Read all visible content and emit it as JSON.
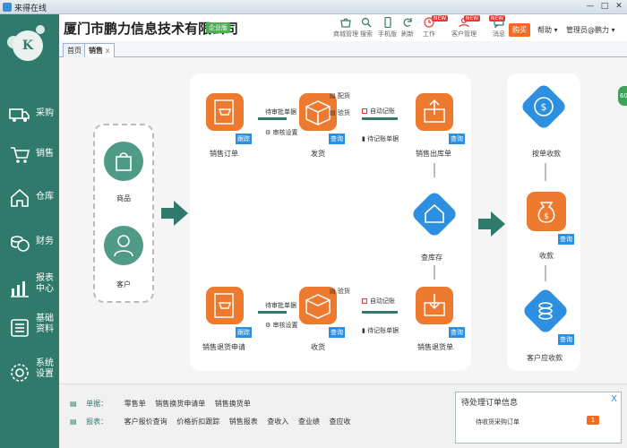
{
  "window": {
    "title": "来得在线",
    "min": "—",
    "max": "□",
    "close": "✕"
  },
  "sidebar": {
    "logo": "K",
    "items": [
      {
        "label": "采购",
        "icon": "truck-icon"
      },
      {
        "label": "销售",
        "icon": "cart-icon"
      },
      {
        "label": "仓库",
        "icon": "house-icon"
      },
      {
        "label": "财务",
        "icon": "coins-icon"
      },
      {
        "label": "报表中心",
        "line1": "报表",
        "line2": "中心",
        "icon": "bar-chart-icon"
      },
      {
        "label": "基础资料",
        "line1": "基础",
        "line2": "资料",
        "icon": "list-icon"
      },
      {
        "label": "系统设置",
        "line1": "系统",
        "line2": "设置",
        "icon": "gear-icon"
      }
    ]
  },
  "header": {
    "company": "厦门市鹏力信息技术有限公司",
    "edition": "企业版",
    "tools": [
      {
        "label": "商城管理",
        "icon": "store-icon"
      },
      {
        "label": "搜索",
        "icon": "search-icon"
      },
      {
        "label": "手机版",
        "icon": "phone-icon"
      },
      {
        "label": "刷新",
        "icon": "refresh-icon"
      },
      {
        "label": "工作",
        "icon": "clock-icon",
        "badge": "NEW"
      },
      {
        "label": "客户管理",
        "icon": "customer-icon",
        "badge": "NEW"
      },
      {
        "label": "消息",
        "icon": "message-icon",
        "badge": "NEW"
      }
    ],
    "buy": "购买",
    "help": "帮助",
    "user": "管理员@鹏力"
  },
  "tabs": [
    {
      "label": "首页"
    },
    {
      "label": "销售",
      "close": "x"
    }
  ],
  "flow": {
    "left": [
      {
        "label": "商品",
        "icon": "bag-icon"
      },
      {
        "label": "客户",
        "icon": "person-icon"
      }
    ],
    "sales_order": {
      "label": "销售订单",
      "tag": "跟踪"
    },
    "deliver": {
      "label": "发货",
      "tag": "查询"
    },
    "out_stock": {
      "label": "销售出库单",
      "tag": "查询"
    },
    "return_req": {
      "label": "销售退货申请",
      "tag": "跟踪"
    },
    "receive": {
      "label": "收货",
      "tag": "查询"
    },
    "return_doc": {
      "label": "销售退货单",
      "tag": "查询"
    },
    "inventory": {
      "label": "查库存"
    },
    "by_order_pay": {
      "label": "按单收款"
    },
    "collect": {
      "label": "收款",
      "tag": "查询"
    },
    "receivable": {
      "label": "客户应收款",
      "tag": "查询"
    },
    "top_mid": {
      "t1": "待审批单据",
      "t2": "审核设置"
    },
    "bottom_mid": {
      "t1": "待审批单据",
      "t2": "审核设置"
    },
    "top_right": {
      "t1": "配货",
      "t2": "验货",
      "t3": "自动记账",
      "t4": "待记账单据"
    },
    "bottom_right": {
      "t1": "验货",
      "t2": "自动记账",
      "t3": "待记账单据"
    }
  },
  "bottom": {
    "docs_title": "单据：",
    "docs": [
      "零售单",
      "销售换货申请单",
      "销售换货单"
    ],
    "reports_title": "报表：",
    "reports": [
      "客户报价查询",
      "价格折扣跟踪",
      "销售报表",
      "查收入",
      "查业绩",
      "查应收"
    ]
  },
  "popup": {
    "title": "待处理订单信息",
    "close": "X",
    "row": "待收货采购订单",
    "count": "1"
  },
  "side_badge": "60"
}
